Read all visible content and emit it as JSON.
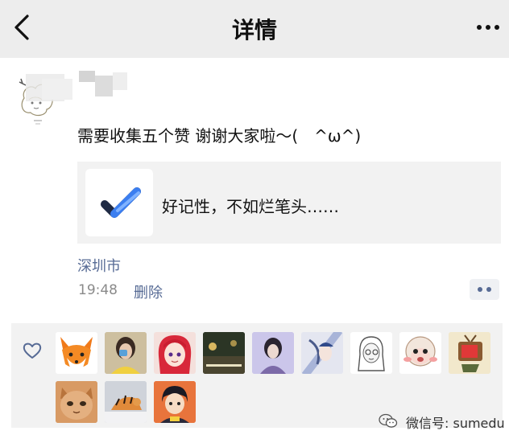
{
  "nav": {
    "title": "详情",
    "back_icon": "chevron-left-icon",
    "more_icon": "more-icon"
  },
  "post": {
    "text": "需要收集五个赞 谢谢大家啦～(　^ω^)",
    "link_card": {
      "icon": "checkmark-app-icon",
      "title": "好记性，不如烂笔头……"
    },
    "location": "深圳市",
    "time": "19:48",
    "delete_label": "删除",
    "action_icon": "comment-like-menu-icon"
  },
  "likes": {
    "icon": "heart-outline-icon",
    "count": 12
  },
  "watermark": {
    "icon": "wechat-icon",
    "text": "微信号: sumedu"
  },
  "colors": {
    "link": "#576b95",
    "nav_bg": "#ededed",
    "card_bg": "#f2f2f2",
    "time": "#8a8a8a"
  }
}
